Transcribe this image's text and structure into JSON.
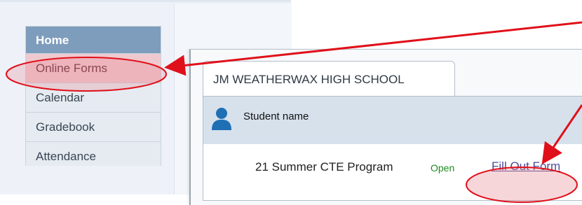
{
  "sidebar": {
    "items": [
      {
        "label": "Home"
      },
      {
        "label": "Online Forms"
      },
      {
        "label": "Calendar"
      },
      {
        "label": "Gradebook"
      },
      {
        "label": "Attendance"
      }
    ]
  },
  "forms_panel": {
    "school_tab": "JM WEATHERWAX HIGH SCHOOL",
    "student_name": "Student name",
    "form": {
      "name": "21 Summer CTE Program",
      "status": "Open",
      "action": "Fill Out Form"
    }
  },
  "colors": {
    "annotation": "#e0101a",
    "highlight": "#efc9cf",
    "home_bg": "#7e9dbc",
    "status_open": "#1e8a1e",
    "link": "#4a4d9a"
  },
  "icons": [
    "user-icon"
  ]
}
